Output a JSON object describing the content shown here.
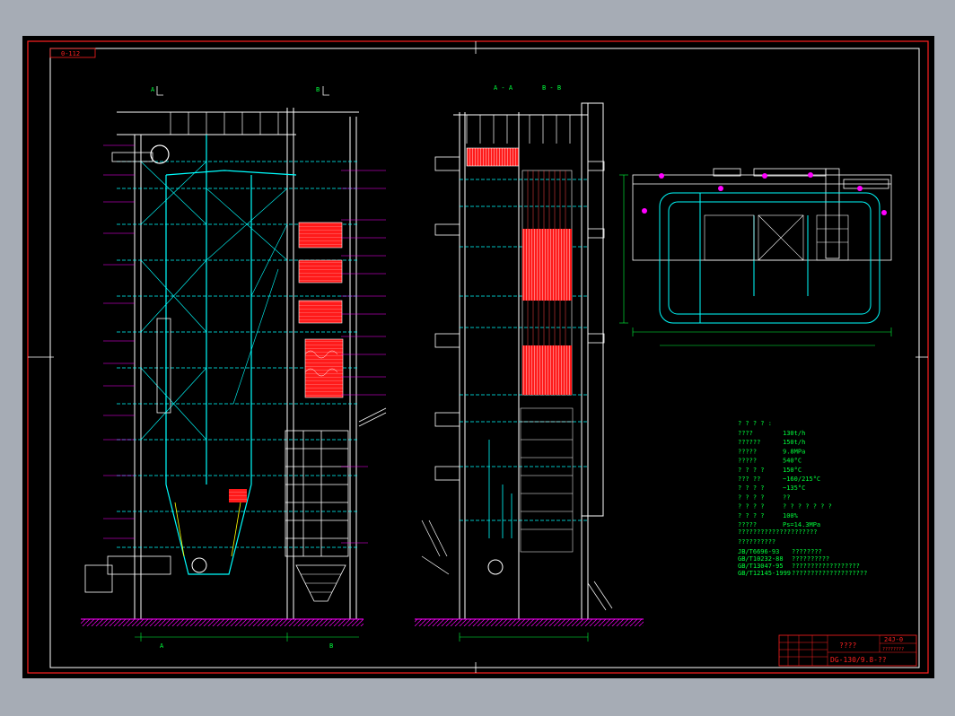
{
  "colors": {
    "outer_bg": "#a6acb5",
    "sheet": "#000000",
    "frame_red": "#ff2020",
    "frame_white": "#ffffff",
    "struct": "#ffffff",
    "pipe": "#00ffff",
    "green": "#00ff3c",
    "magenta": "#ff00ff",
    "red_fill": "#ff1a1a",
    "yellow": "#ffff00",
    "blue": "#4060ff"
  },
  "drawing": {
    "sheet_tag": "0-112",
    "section_labels": {
      "side_view_a": "A",
      "side_view_b": "B",
      "section_aa": "A - A",
      "section_bb": "B - B",
      "bottom_a": "A",
      "bottom_b": "B"
    }
  },
  "specs": {
    "heading": "? ? ? ? :",
    "rows": [
      {
        "label": "????",
        "value": "130t/h"
      },
      {
        "label": "??????",
        "value": "150t/h"
      },
      {
        "label": "?????",
        "value": "9.8MPa"
      },
      {
        "label": "?????",
        "value": "540°C"
      },
      {
        "label": "? ? ? ?",
        "value": "150°C"
      },
      {
        "label": "??? ??",
        "value": "~160/215°C"
      },
      {
        "label": "? ? ? ?",
        "value": "~135°C"
      },
      {
        "label": "? ? ?  ?",
        "value": "??"
      },
      {
        "label": "? ? ? ?",
        "value": "? ? ? ? ? ? ?"
      },
      {
        "label": "? ? ? ?",
        "value": "100%"
      },
      {
        "label": "?????",
        "value": "Ps=14.3MPa"
      }
    ],
    "standards_heading": "?????????????????????",
    "standards_sub": "??????????",
    "standards": [
      {
        "code": "JB/T6696-93",
        "desc": "????????"
      },
      {
        "code": "GB/T10232-88",
        "desc": "??????????"
      },
      {
        "code": "GB/T13047-95",
        "desc": "??????????????????"
      },
      {
        "code": "GB/T12145-1999",
        "desc": "????????????????????"
      }
    ]
  },
  "title_block": {
    "title": "????",
    "drawing_number": "DG-130/9.8-??",
    "sheet_code": "24J-0",
    "note": "????????"
  }
}
